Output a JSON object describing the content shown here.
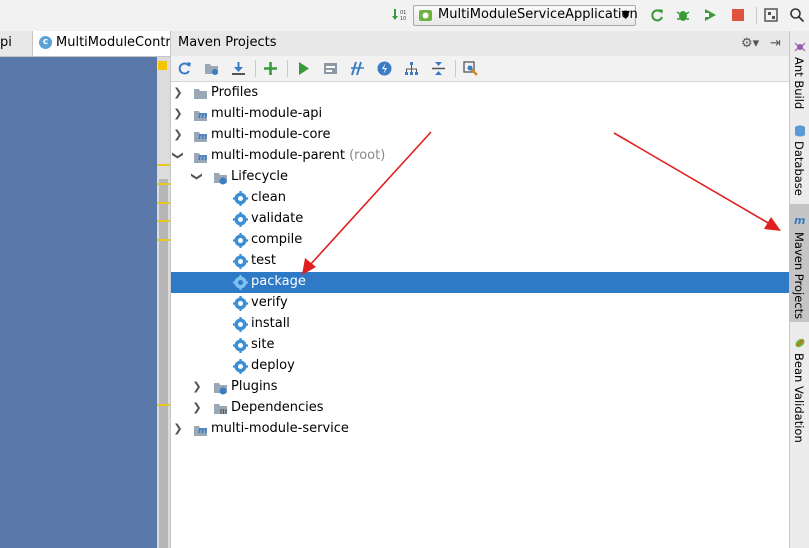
{
  "toolbar": {
    "run_config_label": "MultiModuleServiceApplication",
    "icons": [
      "build-icon",
      "run-config-icon",
      "chevron-down-icon",
      "rerun-icon",
      "debug-icon",
      "coverage-icon",
      "stop-icon",
      "project-structure-icon",
      "search-icon"
    ]
  },
  "editor": {
    "tabs": [
      {
        "label": "pi"
      },
      {
        "label": "MultiModuleContro"
      }
    ]
  },
  "maven": {
    "title": "Maven Projects",
    "tree": [
      {
        "label": "Profiles",
        "suffix": ""
      },
      {
        "label": "multi-module-api",
        "suffix": ""
      },
      {
        "label": "multi-module-core",
        "suffix": ""
      },
      {
        "label": "multi-module-parent",
        "suffix": "(root)"
      },
      {
        "label": "Lifecycle",
        "suffix": ""
      },
      {
        "label": "clean",
        "suffix": ""
      },
      {
        "label": "validate",
        "suffix": ""
      },
      {
        "label": "compile",
        "suffix": ""
      },
      {
        "label": "test",
        "suffix": ""
      },
      {
        "label": "package",
        "suffix": ""
      },
      {
        "label": "verify",
        "suffix": ""
      },
      {
        "label": "install",
        "suffix": ""
      },
      {
        "label": "site",
        "suffix": ""
      },
      {
        "label": "deploy",
        "suffix": ""
      },
      {
        "label": "Plugins",
        "suffix": ""
      },
      {
        "label": "Dependencies",
        "suffix": ""
      },
      {
        "label": "multi-module-service",
        "suffix": ""
      }
    ],
    "selected_item": "package"
  },
  "right_stripe": {
    "tabs": [
      {
        "label": "Ant Build"
      },
      {
        "label": "Database"
      },
      {
        "label": "Maven Projects"
      },
      {
        "label": "Bean Validation"
      }
    ],
    "active_tab": "Maven Projects"
  },
  "colors": {
    "selection": "#2f7ac6",
    "editor_bg": "#5b78aa",
    "annotation_arrow": "#e02020"
  }
}
